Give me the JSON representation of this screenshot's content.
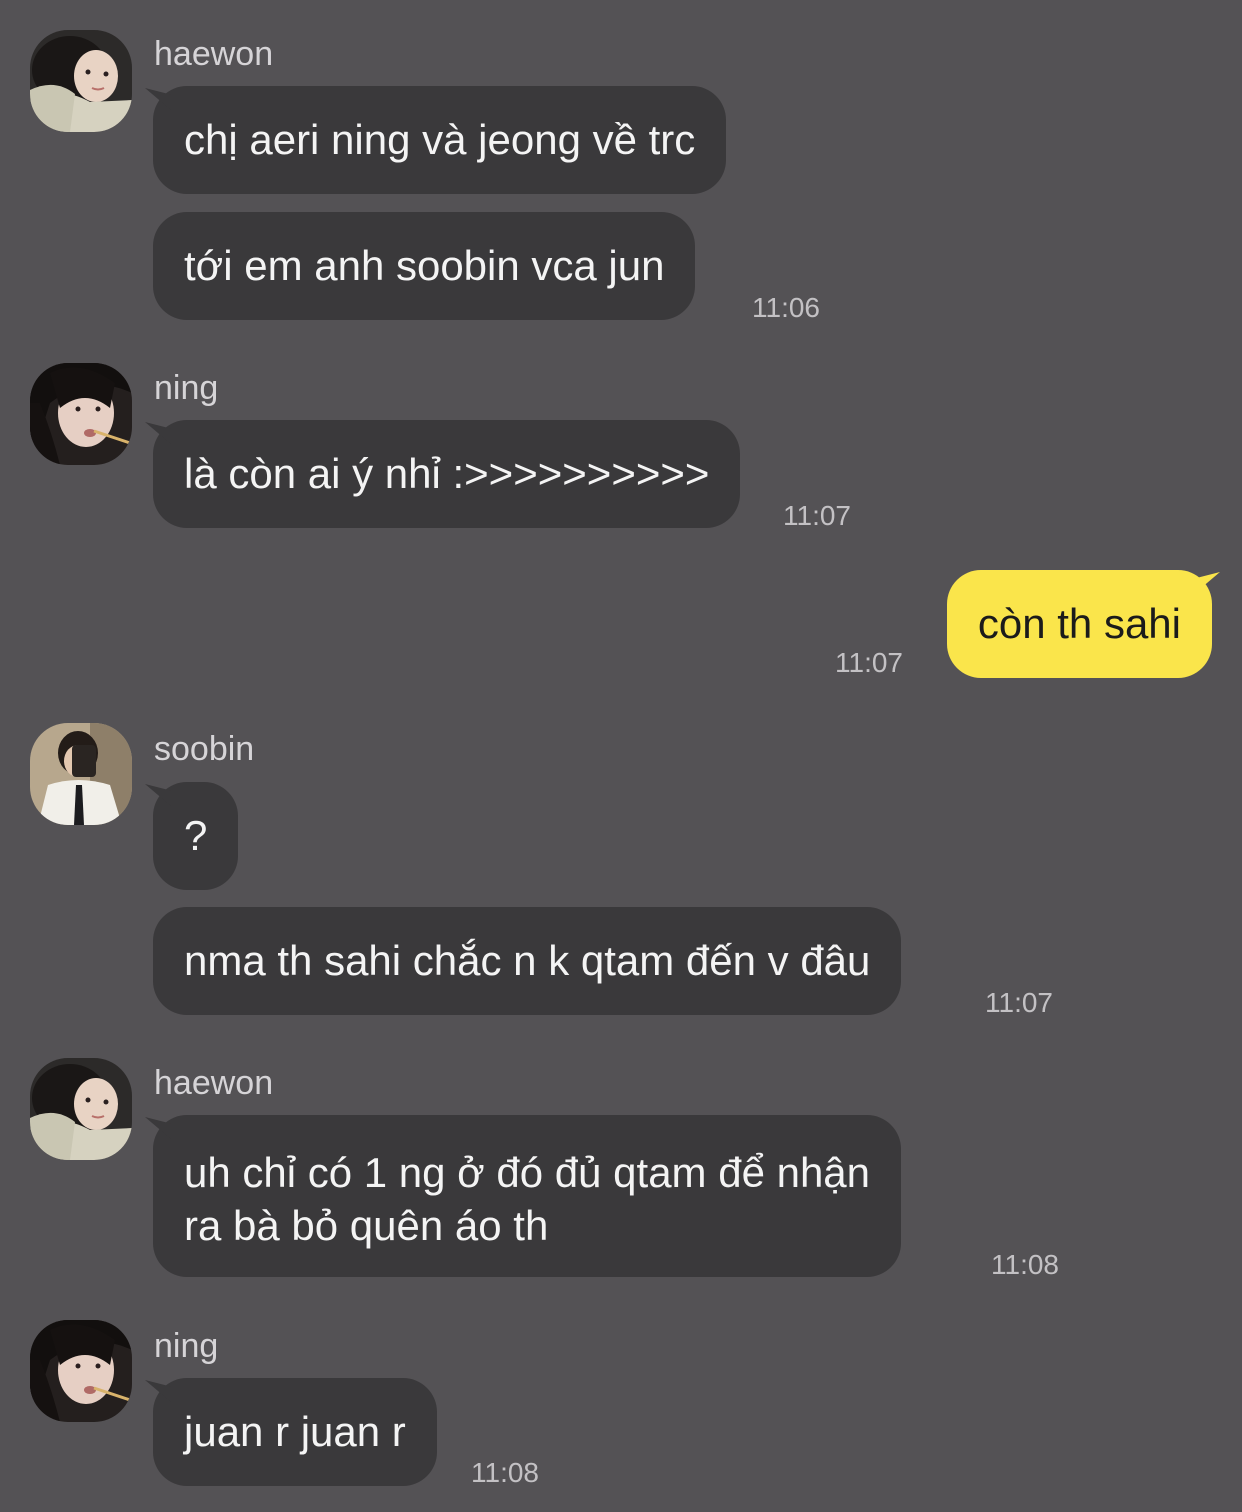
{
  "chat": {
    "groups": [
      {
        "sender": "haewon",
        "avatar": "haewon-avatar",
        "messages": [
          {
            "text": "chị aeri ning và jeong về trc"
          },
          {
            "text": "tới em anh soobin vca jun",
            "time": "11:06"
          }
        ]
      },
      {
        "sender": "ning",
        "avatar": "ning-avatar",
        "messages": [
          {
            "text": "là còn ai ý nhỉ :>>>>>>>>>>",
            "time": "11:07"
          }
        ]
      },
      {
        "sender": "me",
        "messages": [
          {
            "text": "còn th sahi",
            "time": "11:07"
          }
        ]
      },
      {
        "sender": "soobin",
        "avatar": "soobin-avatar",
        "messages": [
          {
            "text": "?"
          },
          {
            "text": "nma th sahi chắc n k qtam đến v đâu",
            "time": "11:07"
          }
        ]
      },
      {
        "sender": "haewon",
        "avatar": "haewon-avatar",
        "messages": [
          {
            "text": "uh chỉ có 1 ng ở đó đủ qtam để nhận",
            "text2": "ra bà bỏ quên áo th",
            "time": "11:08"
          }
        ]
      },
      {
        "sender": "ning",
        "avatar": "ning-avatar",
        "messages": [
          {
            "text": "juan r juan r",
            "time": "11:08"
          }
        ]
      }
    ]
  },
  "colors": {
    "background": "#545255",
    "incoming_bubble": "#3a393b",
    "outgoing_bubble": "#fae54b"
  }
}
